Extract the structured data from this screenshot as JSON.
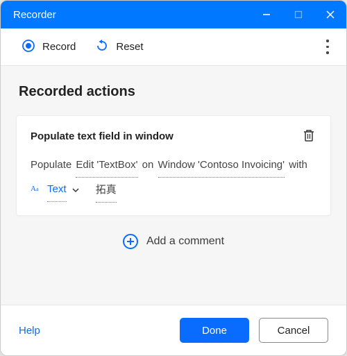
{
  "titlebar": {
    "title": "Recorder"
  },
  "toolbar": {
    "record_label": "Record",
    "reset_label": "Reset"
  },
  "body": {
    "section_title": "Recorded actions",
    "action": {
      "title": "Populate text field in window",
      "sentence": {
        "pre": "Populate ",
        "target1": "Edit 'TextBox'",
        "mid1": " on ",
        "target2": "Window 'Contoso Invoicing'",
        "mid2": " with",
        "text_token_label": "Text",
        "value": "拓真"
      }
    },
    "add_comment_label": "Add a comment"
  },
  "footer": {
    "help_label": "Help",
    "done_label": "Done",
    "cancel_label": "Cancel"
  }
}
